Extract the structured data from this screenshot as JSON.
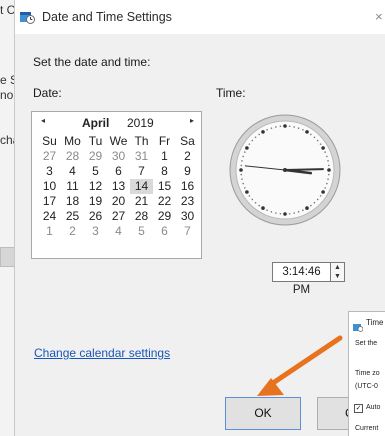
{
  "background_window": {
    "fragments": [
      "t C",
      "e S",
      "nou",
      "cha"
    ]
  },
  "dialog": {
    "title": "Date and Time Settings",
    "close_glyph": "×",
    "heading": "Set the date and time:",
    "date_label": "Date:",
    "time_label": "Time:",
    "calendar": {
      "month": "April",
      "year": "2019",
      "prev_glyph": "◂",
      "next_glyph": "▸",
      "weekdays": [
        "Su",
        "Mo",
        "Tu",
        "We",
        "Th",
        "Fr",
        "Sa"
      ],
      "days": [
        "27",
        "28",
        "29",
        "30",
        "31",
        "1",
        "2",
        "3",
        "4",
        "5",
        "6",
        "7",
        "8",
        "9",
        "10",
        "11",
        "12",
        "13",
        "14",
        "15",
        "16",
        "17",
        "18",
        "19",
        "20",
        "21",
        "22",
        "23",
        "24",
        "25",
        "26",
        "27",
        "28",
        "29",
        "30",
        "1",
        "2",
        "3",
        "4",
        "5",
        "6",
        "7"
      ],
      "other_month_indices": [
        0,
        1,
        2,
        3,
        4,
        35,
        36,
        37,
        38,
        39,
        40,
        41
      ],
      "selected_index": 18
    },
    "clock": {
      "hour": 3,
      "minute": 14,
      "second": 46
    },
    "time_value": "3:14:46 PM",
    "spin_up_glyph": "▲",
    "spin_down_glyph": "▼",
    "change_calendar_link": "Change calendar settings",
    "ok_label": "OK",
    "cancel_label": "Car"
  },
  "overlay_window": {
    "title": "Time",
    "lines": [
      "Set the",
      "Time zo",
      "(UTC-0",
      "Auto",
      "Current"
    ],
    "checkbox_glyph": "✓"
  },
  "colors": {
    "link": "#1a56b7",
    "arrow": "#e8731f",
    "ok_border": "#5b8fd6"
  }
}
